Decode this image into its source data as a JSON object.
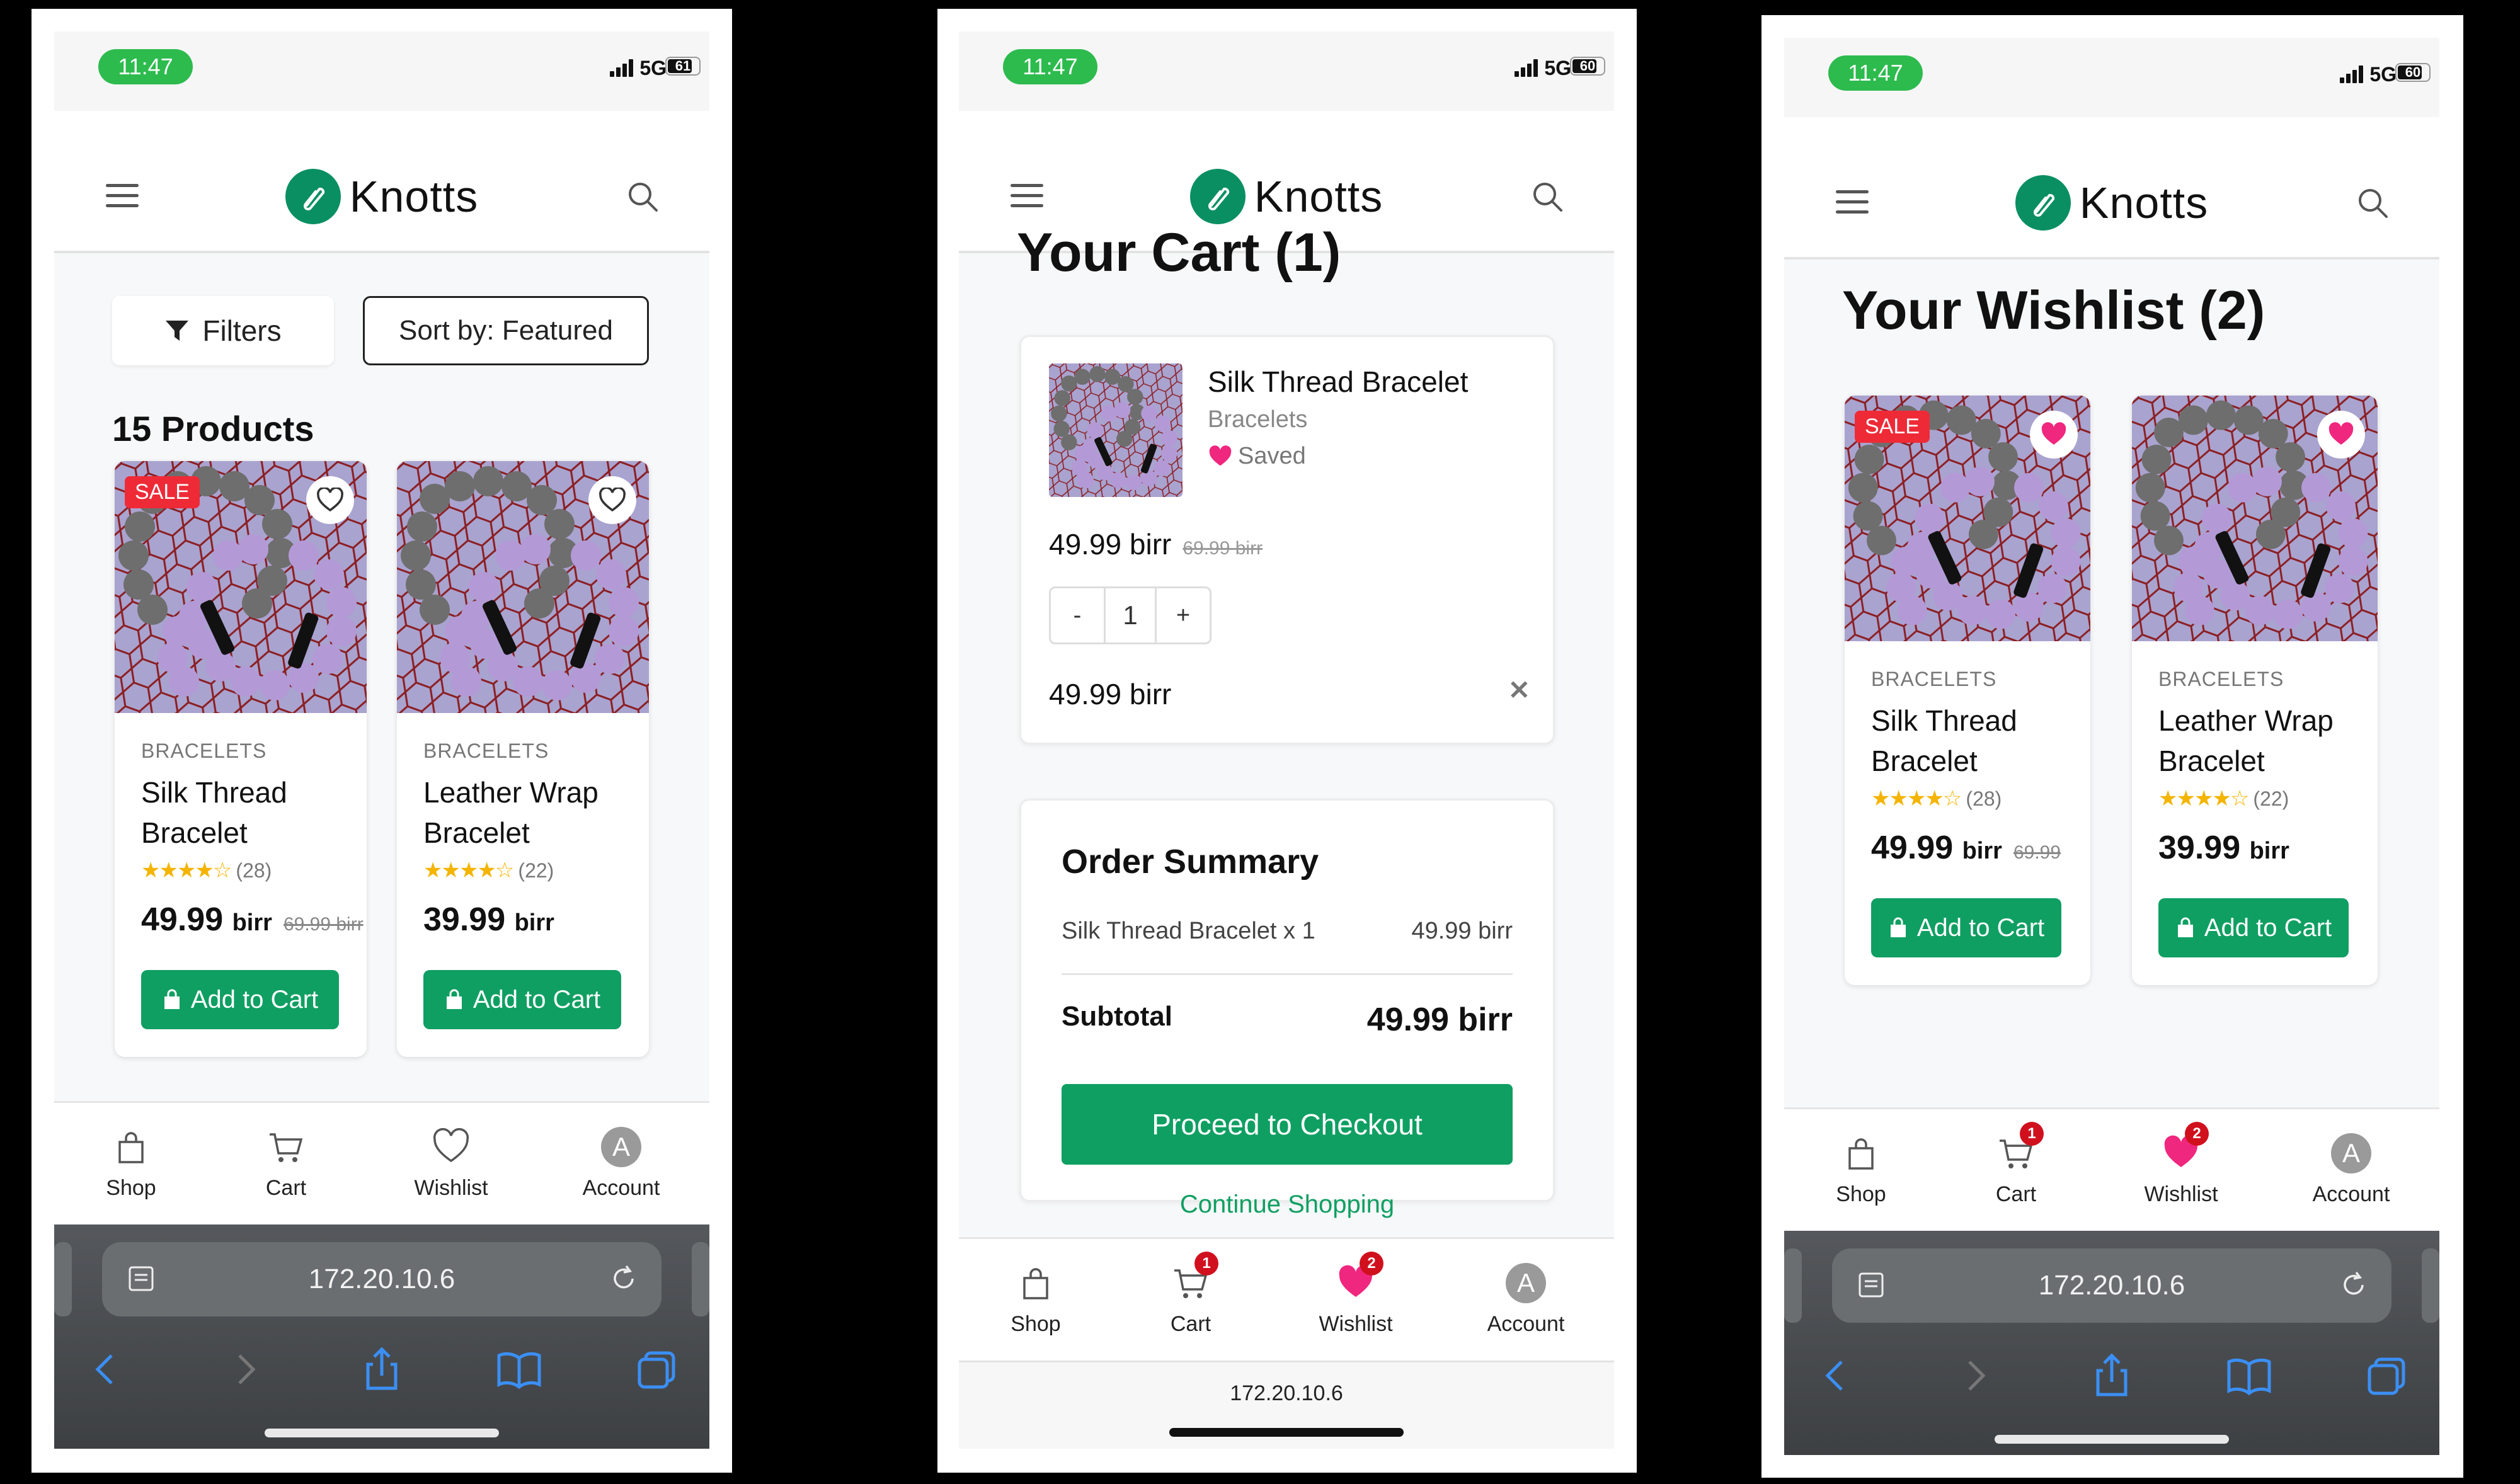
{
  "colors": {
    "brand": "#0f9f62",
    "sale": "#ef2a37",
    "badge": "#d1101e",
    "heart": "#f0277e",
    "status_time": "#2dbb4e"
  },
  "status": {
    "time": "11:47",
    "network": "5G",
    "battery_1": "61",
    "battery_2": "60",
    "battery_3": "60"
  },
  "brand": {
    "name": "Knotts"
  },
  "icons": {
    "menu": "hamburger-icon",
    "search": "search-icon",
    "filter": "funnel-icon",
    "heart": "heart-icon",
    "bag": "bag-icon",
    "cart": "cart-icon"
  },
  "shop": {
    "filters_label": "Filters",
    "sort_label": "Sort by: Featured",
    "product_count": "15 Products"
  },
  "products": [
    {
      "sale_badge": "SALE",
      "category": "BRACELETS",
      "name_line1": "Silk Thread",
      "name_line2": "Bracelet",
      "rating": 4,
      "reviews": "(28)",
      "price": "49.99",
      "currency": "birr",
      "old_price": "69.99 birr",
      "add_label": "Add to Cart"
    },
    {
      "category": "BRACELETS",
      "name_line1": "Leather Wrap",
      "name_line2": "Bracelet",
      "rating": 4,
      "reviews": "(22)",
      "price": "39.99",
      "currency": "birr",
      "add_label": "Add to Cart"
    }
  ],
  "tabs": {
    "shop": "Shop",
    "cart": "Cart",
    "wishlist": "Wishlist",
    "account": "Account",
    "account_initial": "A"
  },
  "badges": {
    "cart": "1",
    "wishlist": "2"
  },
  "browser": {
    "url": "172.20.10.6"
  },
  "cart": {
    "title": "Your Cart (1)",
    "item": {
      "name": "Silk Thread Bracelet",
      "category": "Bracelets",
      "saved": "Saved",
      "price": "49.99 birr",
      "old_price": "69.99 birr",
      "qty": "1",
      "minus": "-",
      "plus": "+",
      "line_total": "49.99 birr",
      "remove": "✕"
    },
    "summary": {
      "title": "Order Summary",
      "line_label": "Silk Thread Bracelet x 1",
      "line_value": "49.99 birr",
      "subtotal_label": "Subtotal",
      "subtotal_value": "49.99 birr",
      "checkout": "Proceed to Checkout",
      "continue": "Continue Shopping"
    }
  },
  "wishlist": {
    "title": "Your Wishlist (2)",
    "old_price_cut": "69.99 "
  }
}
